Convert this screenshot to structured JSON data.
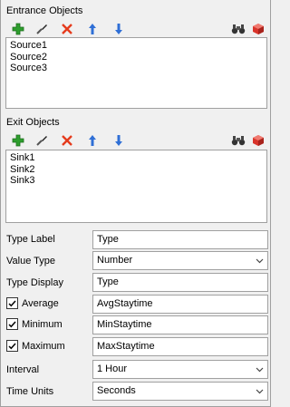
{
  "entrance": {
    "title": "Entrance Objects",
    "items": [
      "Source1",
      "Source2",
      "Source3"
    ]
  },
  "exit": {
    "title": "Exit Objects",
    "items": [
      "Sink1",
      "Sink2",
      "Sink3"
    ]
  },
  "toolbar_icons": [
    "add-icon",
    "eyedropper-icon",
    "delete-icon",
    "move-up-icon",
    "move-down-icon",
    "binoculars-icon",
    "select-object-icon"
  ],
  "form": {
    "type_label": {
      "label": "Type Label",
      "value": "Type"
    },
    "value_type": {
      "label": "Value Type",
      "value": "Number"
    },
    "type_display": {
      "label": "Type Display",
      "value": "Type"
    },
    "average": {
      "label": "Average",
      "value": "AvgStaytime",
      "checked": true
    },
    "minimum": {
      "label": "Minimum",
      "value": "MinStaytime",
      "checked": true
    },
    "maximum": {
      "label": "Maximum",
      "value": "MaxStaytime",
      "checked": true
    },
    "interval": {
      "label": "Interval",
      "value": "1 Hour"
    },
    "time_units": {
      "label": "Time Units",
      "value": "Seconds"
    }
  },
  "colors": {
    "add": "#2e9e2e",
    "delete": "#e53b1c",
    "arrow": "#2f6fd6",
    "cube": "#d9342b"
  }
}
